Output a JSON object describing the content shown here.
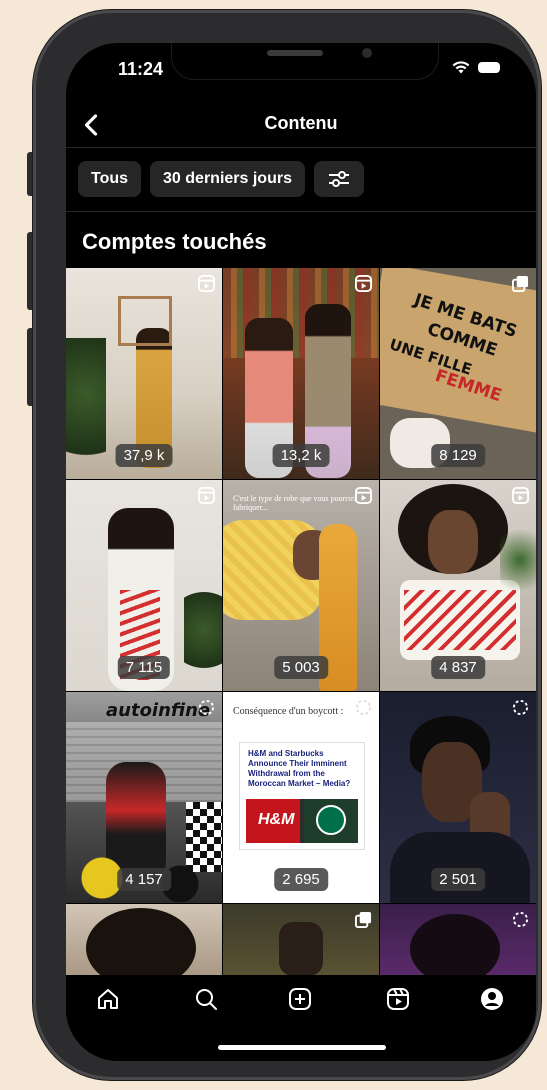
{
  "status_bar": {
    "time": "11:24"
  },
  "header": {
    "back_icon": "chevron-left-icon",
    "title": "Contenu"
  },
  "filters": [
    {
      "label": "Tous"
    },
    {
      "label": "30 derniers jours"
    }
  ],
  "filter_settings_icon": "sliders-icon",
  "section_title": "Comptes touchés",
  "posts": [
    {
      "type": "reel",
      "count": "37,9 k"
    },
    {
      "type": "reel",
      "count": "13,2 k"
    },
    {
      "type": "carousel",
      "count": "8 129",
      "sign_lines": [
        "JE ME BATS",
        "COMME",
        "UNE FILLE",
        "FEMME"
      ]
    },
    {
      "type": "reel",
      "count": "7 115"
    },
    {
      "type": "reel",
      "count": "5 003",
      "caption": "C'est le type de robe que vous pourriez fabriquer..."
    },
    {
      "type": "reel",
      "count": "4 837"
    },
    {
      "type": "story",
      "count": "4 157",
      "overlay_text": "autoinfine"
    },
    {
      "type": "story",
      "count": "2 695",
      "caption": "Conséquence d'un boycott :",
      "article_headline": "H&M and Starbucks Announce Their Imminent Withdrawal from the Moroccan Market – Media?"
    },
    {
      "type": "story",
      "count": "2 501"
    },
    {
      "type": "none"
    },
    {
      "type": "carousel"
    },
    {
      "type": "story"
    }
  ],
  "bottom_nav": [
    "home-icon",
    "search-icon",
    "create-icon",
    "reels-icon",
    "profile-icon"
  ]
}
